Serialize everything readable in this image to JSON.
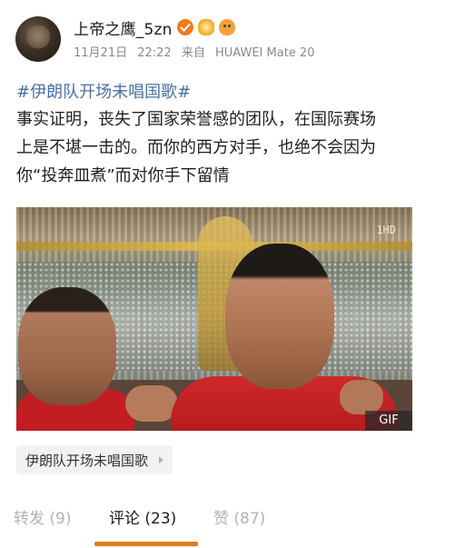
{
  "post": {
    "author": {
      "name": "上帝之鹰_5zn",
      "badges": [
        "verified-badge-icon",
        "flower-badge-icon",
        "cat-badge-icon"
      ]
    },
    "meta": {
      "date": "11月21日",
      "time": "22:22",
      "source_prefix": "来自",
      "device": "HUAWEI Mate 20"
    },
    "hashtag": "#伊朗队开场未唱国歌#",
    "text_lines": [
      "事实证明，丧失了国家荣誉感的团队，在国际赛场",
      "上是不堪一击的。而你的西方对手，也绝不会因为",
      "你“投奔皿煮”而对你手下留情"
    ],
    "media": {
      "type_badge": "GIF",
      "watermark": "1HD"
    },
    "topic_chip": {
      "label": "伊朗队开场未唱国歌"
    }
  },
  "tabs": [
    {
      "label": "转发",
      "count": "(9)",
      "active": false
    },
    {
      "label": "评论",
      "count": "(23)",
      "active": true
    },
    {
      "label": "赞",
      "count": "(87)",
      "active": false
    }
  ],
  "colors": {
    "accent": "#e07a1f",
    "hashtag": "#4a6fa5",
    "muted": "#8a8a8a",
    "inactive_tab": "#b3b3b3"
  }
}
